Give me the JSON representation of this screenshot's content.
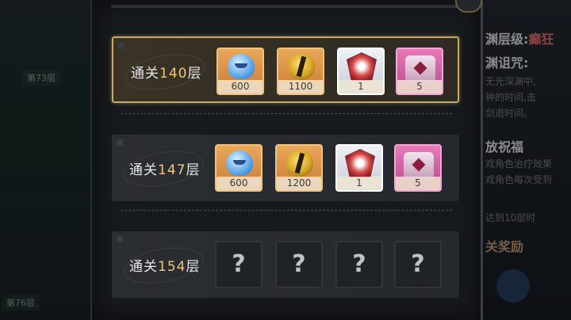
{
  "background": {
    "left_floors": [
      "第73层",
      "第76层"
    ],
    "right_panel": {
      "title_prefix": "渊层级:",
      "title_value": "癫狂",
      "subtitle": "渊诅咒:",
      "lines": [
        "无光深渊中,",
        "钟的时间,击",
        "剑退时间。"
      ],
      "bless_title": "放祝福",
      "bless_lines": [
        "戏角色治疗效果",
        "戏角色每次受到",
        "达到10层时",
        "关奖励"
      ]
    }
  },
  "rewards": {
    "rows": [
      {
        "label_prefix": "通关",
        "floor": "140",
        "label_suffix": "层",
        "active": true,
        "items": [
          {
            "icon": "blue-slime-icon",
            "qty": "600",
            "frame": "orange"
          },
          {
            "icon": "gold-helmet-icon",
            "qty": "1100",
            "frame": "orange"
          },
          {
            "icon": "red-crest-icon",
            "qty": "1",
            "frame": "silver"
          },
          {
            "icon": "pink-chest-icon",
            "qty": "5",
            "frame": "pink"
          }
        ]
      },
      {
        "label_prefix": "通关",
        "floor": "147",
        "label_suffix": "层",
        "active": false,
        "items": [
          {
            "icon": "blue-slime-icon",
            "qty": "600",
            "frame": "orange"
          },
          {
            "icon": "gold-helmet-icon",
            "qty": "1200",
            "frame": "orange"
          },
          {
            "icon": "red-crest-icon",
            "qty": "1",
            "frame": "silver"
          },
          {
            "icon": "pink-chest-icon",
            "qty": "5",
            "frame": "pink"
          }
        ]
      },
      {
        "label_prefix": "通关",
        "floor": "154",
        "label_suffix": "层",
        "active": false,
        "items": [
          {
            "icon": "unknown-reward-icon",
            "qty": "?",
            "frame": "empty"
          },
          {
            "icon": "unknown-reward-icon",
            "qty": "?",
            "frame": "empty"
          },
          {
            "icon": "unknown-reward-icon",
            "qty": "?",
            "frame": "empty"
          },
          {
            "icon": "unknown-reward-icon",
            "qty": "?",
            "frame": "empty"
          }
        ]
      }
    ]
  },
  "colors": {
    "highlight_border": "#c7a96a",
    "floor_number": "#f0c77a",
    "panel_bg": "#16191d"
  }
}
